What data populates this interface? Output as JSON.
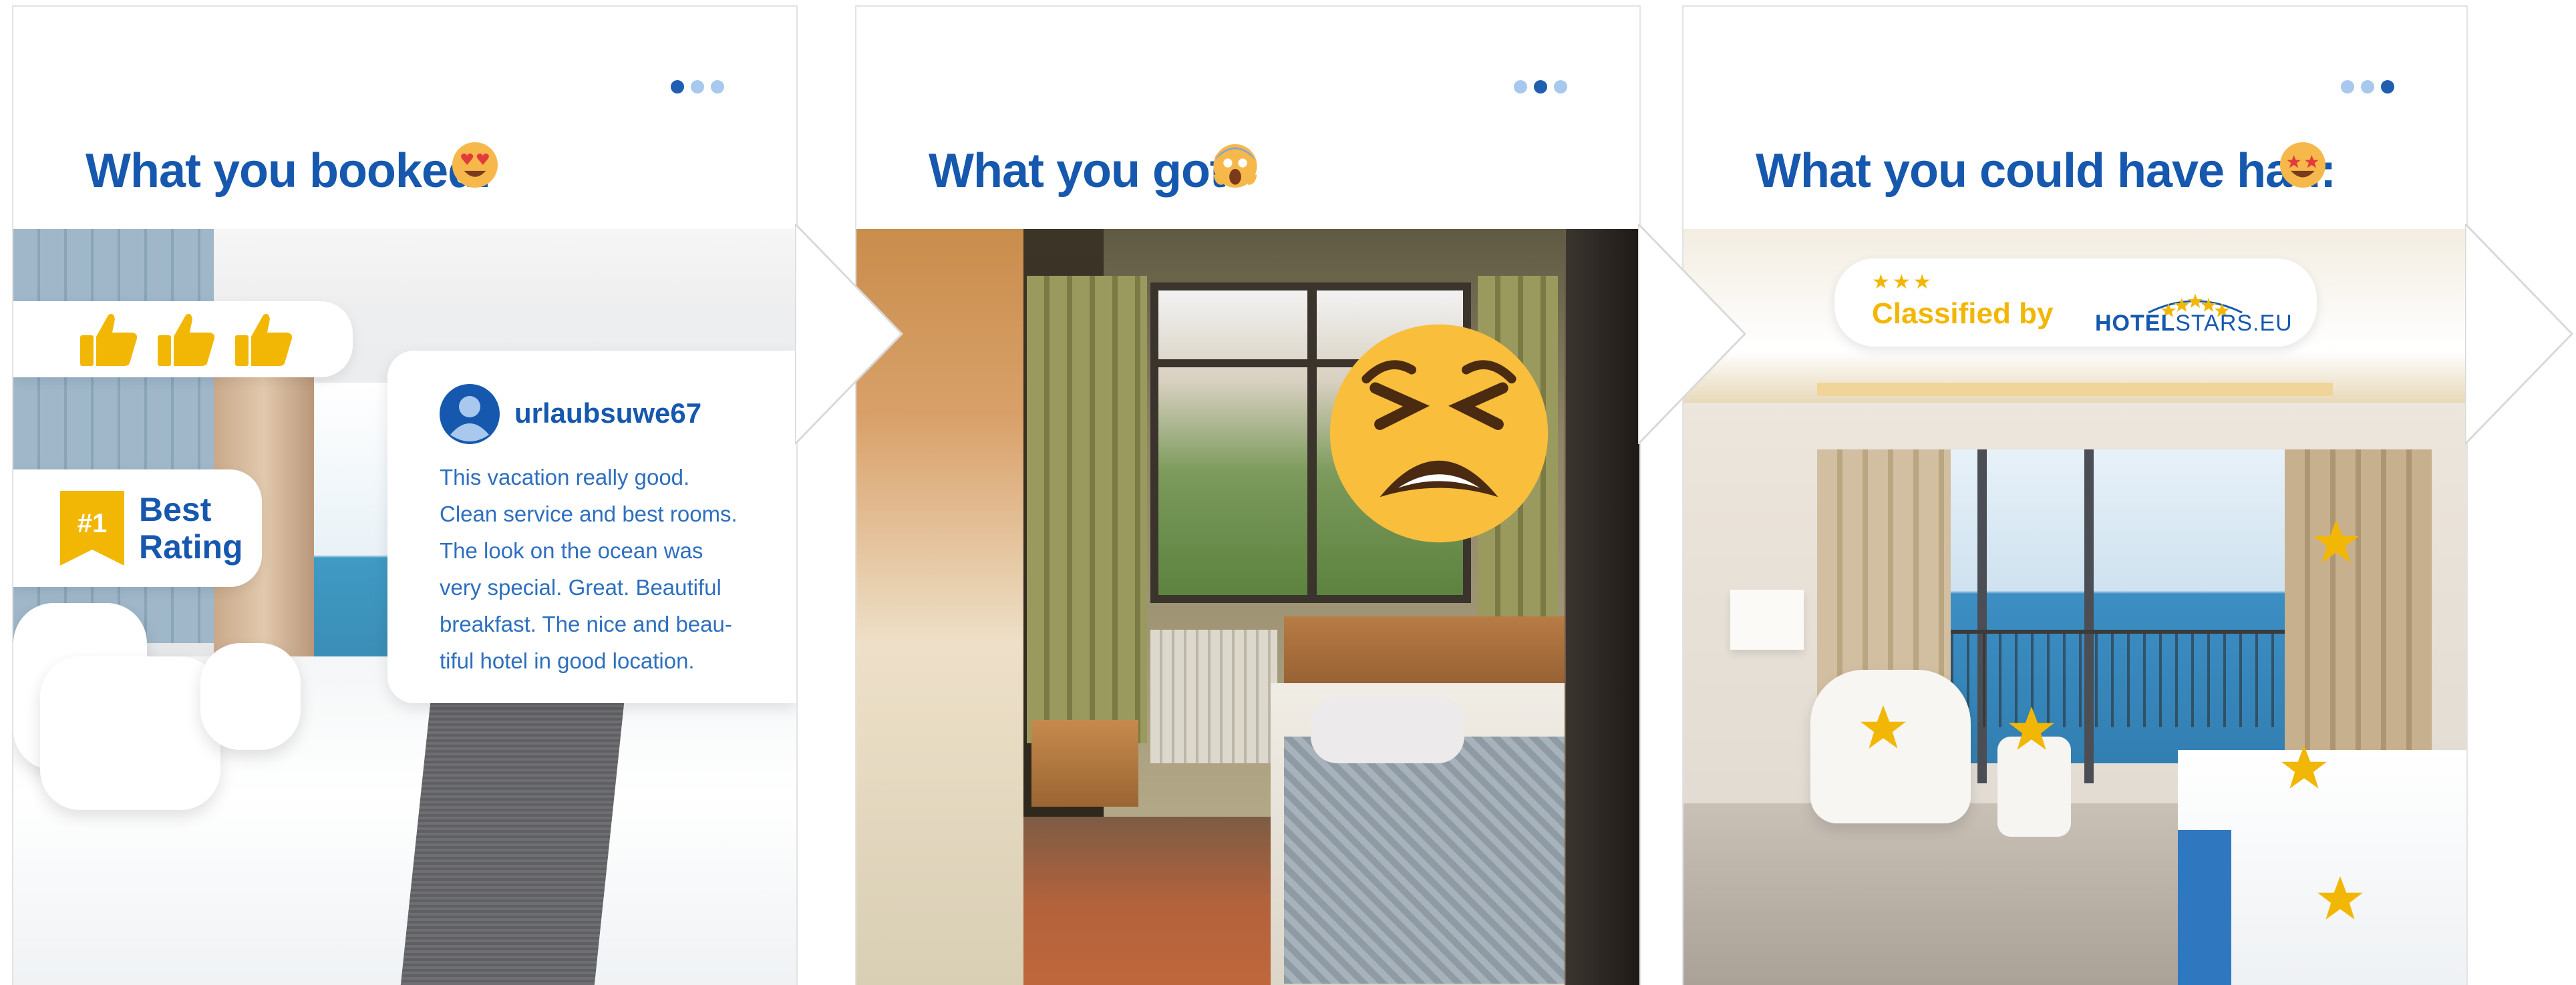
{
  "colors": {
    "brand_blue": "#1658ae",
    "star_gold": "#f2b705",
    "dot_inactive": "#a8c8ee",
    "dot_active": "#1f5eb0"
  },
  "cards": [
    {
      "title": "What you booked:",
      "title_emoji": "heart-eyes-emoji",
      "active_dot": 1,
      "thumbs_icons": [
        "thumbs-up-icon",
        "thumbs-up-icon",
        "thumbs-up-icon"
      ],
      "badge": {
        "rank": "#1",
        "line1": "Best",
        "line2": "Rating"
      },
      "review": {
        "username": "urlaubsuwe67",
        "lines": [
          "This vacation really good.",
          "Clean service and best rooms.",
          "The look on the ocean was",
          "very special. Great. Beautiful",
          "breakfast. The nice and beau-",
          "tiful hotel in good location."
        ]
      }
    },
    {
      "title": "What you got:",
      "title_emoji": "screaming-face-emoji",
      "active_dot": 2,
      "overlay_emoji": "tired-face-emoji"
    },
    {
      "title": "What you could have had:",
      "title_emoji": "star-struck-emoji",
      "active_dot": 3,
      "classified": {
        "stars": "★★★",
        "text": "Classified by",
        "logo_bold": "HOTEL",
        "logo_rest": "STARS.EU"
      }
    }
  ]
}
